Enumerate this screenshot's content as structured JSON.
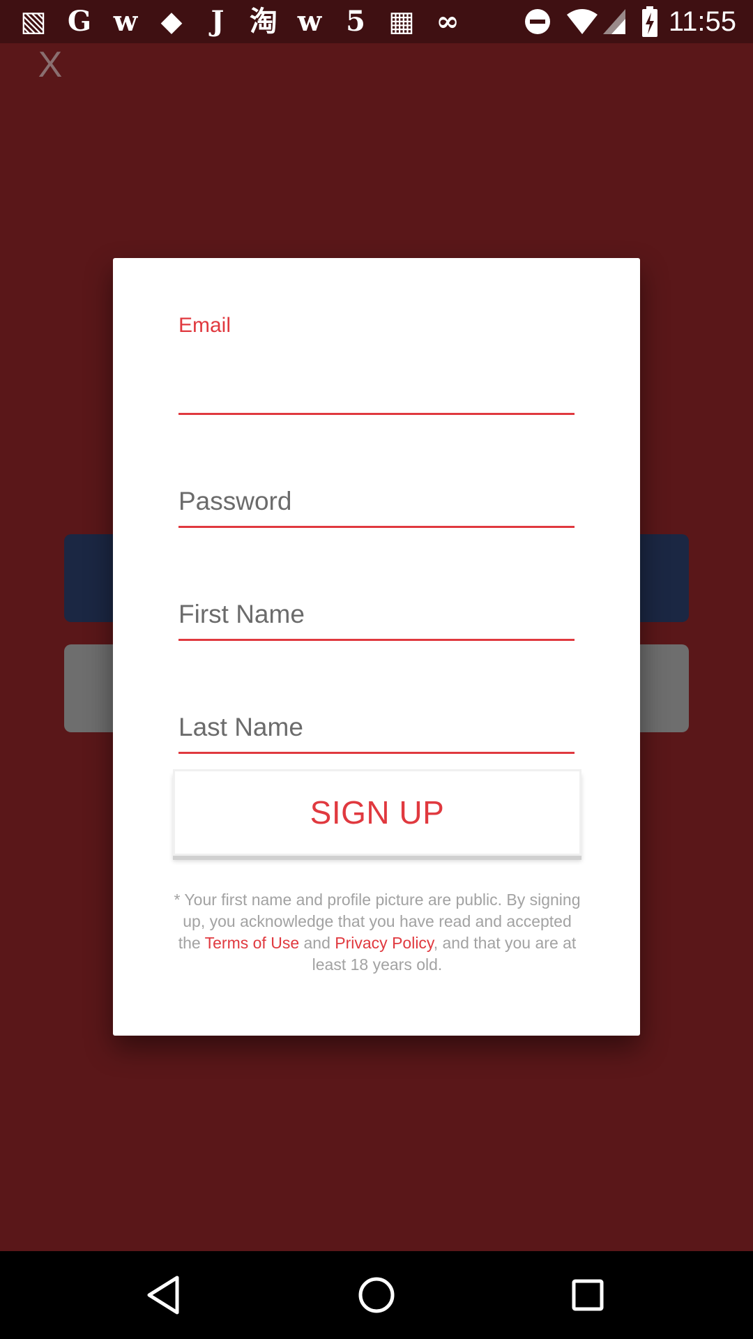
{
  "status_bar": {
    "time": "11:55",
    "notification_icons": [
      {
        "name": "shopping-bag-icon",
        "glyph": "▧"
      },
      {
        "name": "g-app-icon",
        "glyph": "G"
      },
      {
        "name": "w-app-icon",
        "glyph": "w"
      },
      {
        "name": "box-app-icon",
        "glyph": "◆"
      },
      {
        "name": "j-app-icon",
        "glyph": "J"
      },
      {
        "name": "taobao-icon",
        "glyph": "淘"
      },
      {
        "name": "w-app-icon-2",
        "glyph": "w"
      },
      {
        "name": "html5-icon",
        "glyph": "5"
      },
      {
        "name": "grid-app-icon",
        "glyph": "▦"
      },
      {
        "name": "link-app-icon",
        "glyph": "∞"
      }
    ],
    "system_icons": [
      "do-not-disturb-icon",
      "wifi-icon",
      "cell-signal-icon",
      "battery-charging-icon"
    ]
  },
  "header": {
    "close_label": "X"
  },
  "form": {
    "email_label": "Email",
    "password_placeholder": "Password",
    "first_name_placeholder": "First Name",
    "last_name_placeholder": "Last Name",
    "signup_label": "SIGN UP"
  },
  "disclaimer": {
    "part1": "* Your first name and profile picture are public. By signing up, you acknowledge that you have read and accepted the ",
    "terms_link": "Terms of Use",
    "part2": " and ",
    "privacy_link": "Privacy Policy",
    "part3": ", and that you are at least 18 years old."
  },
  "colors": {
    "accent": "#e0393f",
    "backdrop": "#5a1719",
    "status_bar": "#3f1012",
    "bg_button_blue": "#1b2743",
    "bg_button_gray": "#6e6e6e"
  },
  "nav": [
    "back-icon",
    "home-icon",
    "recents-icon"
  ]
}
